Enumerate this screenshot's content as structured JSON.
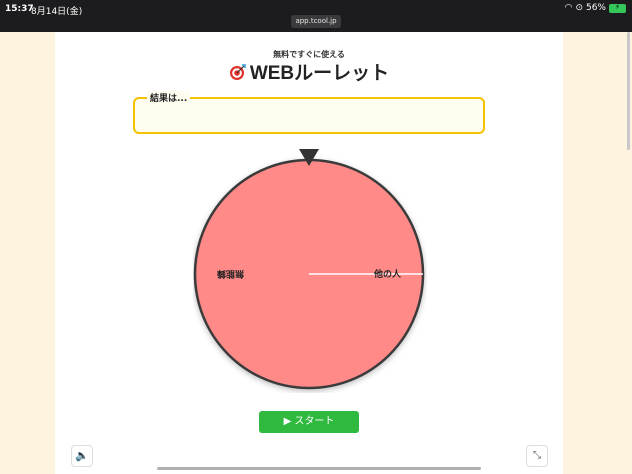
{
  "status_bar": {
    "time": "15:37",
    "date": "8月14日(金)",
    "url": "app.tcool.jp",
    "battery": "56%"
  },
  "header": {
    "subtitle": "無料ですぐに使える",
    "title": "WEBルーレット"
  },
  "result": {
    "label": "結果は..."
  },
  "wheel": {
    "segments": [
      {
        "label": "他の人",
        "color": "#ff8a88"
      },
      {
        "label": "無能鋒",
        "color": "#ff8a88"
      }
    ]
  },
  "controls": {
    "start_label": "▶ スタート",
    "sound_icon": "speaker-icon",
    "expand_icon": "expand-icon"
  }
}
